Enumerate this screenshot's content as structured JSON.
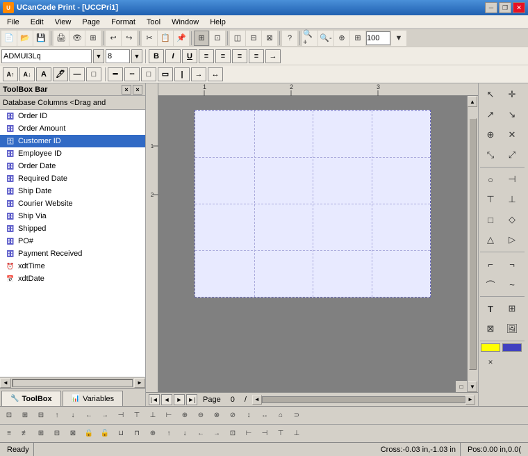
{
  "titleBar": {
    "title": "UCanCode Print - [UCCPri1]",
    "icon": "U",
    "controls": [
      "minimize",
      "restore",
      "close"
    ]
  },
  "menuBar": {
    "items": [
      "File",
      "Edit",
      "View",
      "Page",
      "Format",
      "Tool",
      "Window",
      "Help"
    ]
  },
  "toolbar": {
    "buttons": [
      "new",
      "open",
      "save",
      "print",
      "preview",
      "cut",
      "copy",
      "paste",
      "undo",
      "redo",
      "bold",
      "italic",
      "underline",
      "left",
      "center",
      "right",
      "justify",
      "zoom-in",
      "zoom-out",
      "zoom-100"
    ],
    "zoomValue": "100"
  },
  "fontToolbar": {
    "fontName": "ADMUI3Lq",
    "fontSize": "8",
    "bold": "B",
    "italic": "I",
    "underline": "U"
  },
  "toolbox": {
    "header": "ToolBox Bar",
    "dbColumnsHeader": "Database Columns <Drag and",
    "columns": [
      {
        "name": "Order ID",
        "icon": "db",
        "selected": false
      },
      {
        "name": "Order Amount",
        "icon": "db",
        "selected": false
      },
      {
        "name": "Customer ID",
        "icon": "db",
        "selected": true
      },
      {
        "name": "Employee ID",
        "icon": "db",
        "selected": false
      },
      {
        "name": "Order Date",
        "icon": "db",
        "selected": false
      },
      {
        "name": "Required Date",
        "icon": "db",
        "selected": false
      },
      {
        "name": "Ship Date",
        "icon": "db",
        "selected": false
      },
      {
        "name": "Courier Website",
        "icon": "db",
        "selected": false
      },
      {
        "name": "Ship Via",
        "icon": "db",
        "selected": false
      },
      {
        "name": "Shipped",
        "icon": "db",
        "selected": false
      },
      {
        "name": "PO#",
        "icon": "db",
        "selected": false
      },
      {
        "name": "Payment Received",
        "icon": "db",
        "selected": false
      },
      {
        "name": "xdtTime",
        "icon": "clock",
        "selected": false
      },
      {
        "name": "xdtDate",
        "icon": "key",
        "selected": false
      }
    ],
    "tabs": [
      {
        "label": "ToolBox",
        "active": true
      },
      {
        "label": "Variables",
        "active": false
      }
    ]
  },
  "canvas": {
    "rulerMarks": [
      "1",
      "2",
      "3"
    ],
    "pageNumber": "0",
    "gridLines": {
      "horizontal": [
        25,
        50,
        75
      ],
      "vertical": [
        25,
        50,
        75,
        100
      ]
    }
  },
  "statusBar": {
    "ready": "Ready",
    "crossPos": "Cross:-0.03 in,-1.03 in",
    "pos": "Pos:0.00 in,0.0("
  },
  "rightPanel": {
    "tools": [
      "↖",
      "⊕",
      "↗",
      "↘",
      "⊞",
      "⊡",
      "+",
      "×",
      "○",
      "⊣",
      "⊤",
      "⊥",
      "□",
      "◇",
      "△",
      "▷",
      "⌐",
      "¬",
      "⌒",
      "~",
      "T",
      "⊞",
      "⊠",
      "⊕",
      "■",
      "⊟",
      "⊞",
      "■",
      "×"
    ]
  }
}
